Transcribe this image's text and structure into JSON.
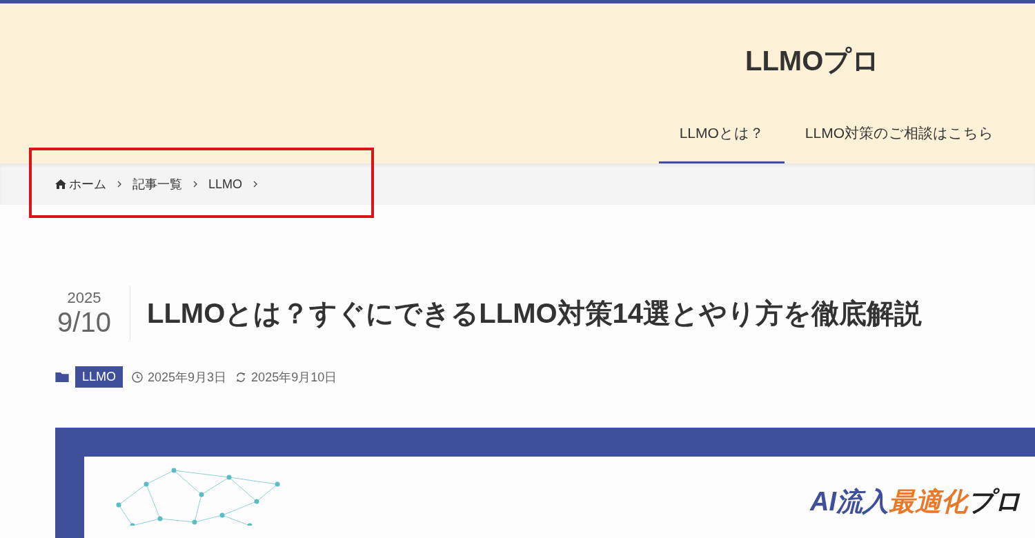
{
  "site": {
    "title": "LLMOプロ"
  },
  "nav": [
    {
      "label": "LLMOとは？",
      "selected": true
    },
    {
      "label": "LLMO対策のご相談はこちら",
      "selected": false
    }
  ],
  "breadcrumb": {
    "highlighted": true,
    "items": [
      {
        "label": "ホーム",
        "kind": "home"
      },
      {
        "label": "記事一覧",
        "kind": "link"
      },
      {
        "label": "LLMO",
        "kind": "link"
      }
    ]
  },
  "post": {
    "year": "2025",
    "date": "9/10",
    "title": "LLMOとは？すぐにできるLLMO対策14選とやり方を徹底解説",
    "category": "LLMO",
    "published": "2025年9月3日",
    "updated": "2025年9月10日"
  },
  "eyecatch": {
    "logo_parts": [
      {
        "text": "AI流入",
        "color": "#3f4f9a"
      },
      {
        "text": "最適化",
        "color": "#e8782a"
      },
      {
        "text": "プロ",
        "color": "#222222"
      }
    ]
  }
}
